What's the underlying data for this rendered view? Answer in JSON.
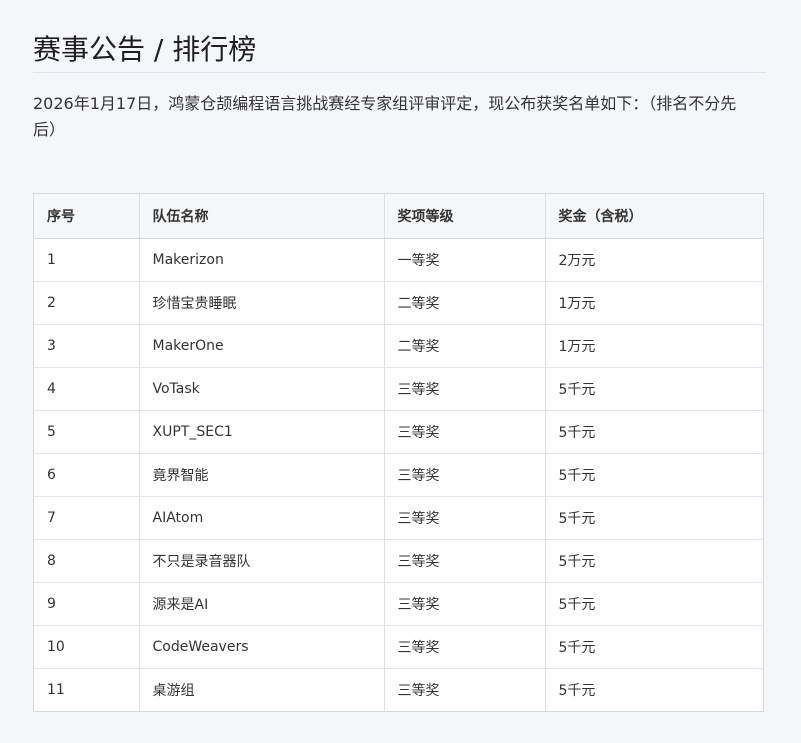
{
  "page": {
    "title": "赛事公告 / 排行榜",
    "intro": "2026年1月17日，鸿蒙仓颉编程语言挑战赛经专家组评审评定，现公布获奖名单如下：（排名不分先后）"
  },
  "table": {
    "headers": [
      "序号",
      "队伍名称",
      "奖项等级",
      "奖金（含税）"
    ],
    "rows": [
      [
        "1",
        "Makerizon",
        "一等奖",
        "2万元"
      ],
      [
        "2",
        "珍惜宝贵睡眠",
        "二等奖",
        "1万元"
      ],
      [
        "3",
        "MakerOne",
        "二等奖",
        "1万元"
      ],
      [
        "4",
        "VoTask",
        "三等奖",
        "5千元"
      ],
      [
        "5",
        "XUPT_SEC1",
        "三等奖",
        "5千元"
      ],
      [
        "6",
        "竟界智能",
        "三等奖",
        "5千元"
      ],
      [
        "7",
        "AIAtom",
        "三等奖",
        "5千元"
      ],
      [
        "8",
        "不只是录音器队",
        "三等奖",
        "5千元"
      ],
      [
        "9",
        "源来是AI",
        "三等奖",
        "5千元"
      ],
      [
        "10",
        "CodeWeavers",
        "三等奖",
        "5千元"
      ],
      [
        "11",
        "桌游组",
        "三等奖",
        "5千元"
      ]
    ]
  }
}
